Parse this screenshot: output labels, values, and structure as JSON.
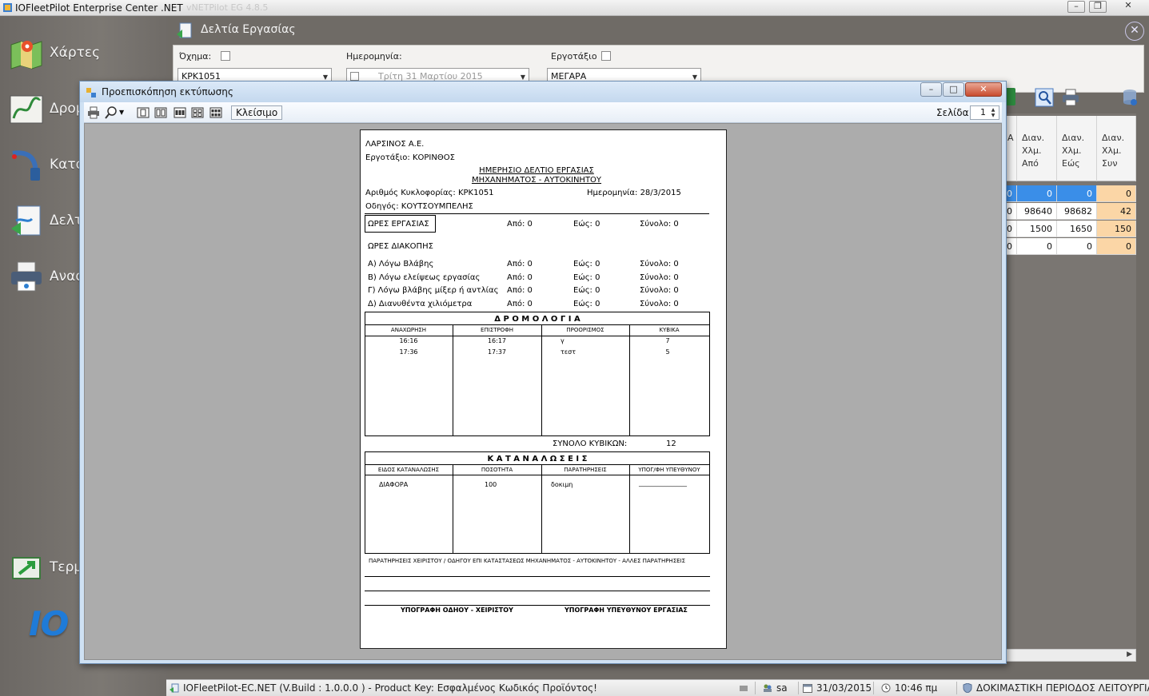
{
  "app": {
    "title": "IOFleetPilot Enterprise Center .NET",
    "title_ghost": "vNETPilot EG 4.8.5"
  },
  "sidebar": {
    "items": [
      {
        "label": "Χάρτες",
        "icon": "map-icon"
      },
      {
        "label": "Δρομ",
        "icon": "route-icon"
      },
      {
        "label": "Κατα",
        "icon": "fuel-pump-icon"
      },
      {
        "label": "Δελτ",
        "icon": "document-icon"
      },
      {
        "label": "Αναφ",
        "icon": "printer-icon"
      },
      {
        "label": "Τερμ",
        "icon": "exit-icon"
      }
    ],
    "logo": "IO"
  },
  "doc_window": {
    "title": "Δελτία Εργασίας",
    "filters": {
      "vehicle_label": "Όχημα:",
      "vehicle_value": "ΚΡΚ1051",
      "date_label": "Ημερομηνία:",
      "date_value": "Τρίτη     31     Μαρτίου     2015",
      "site_label": "Εργοτάξιο",
      "site_value": "ΜΕΓΑΡΑ"
    },
    "grid": {
      "headers": [
        "Α",
        "Διαν. Χλμ. Από",
        "Διαν. Χλμ. Εώς",
        "Διαν. Χλμ. Συν"
      ],
      "rows": [
        [
          "0",
          "0",
          "0",
          "0"
        ],
        [
          "0",
          "98640",
          "98682",
          "42"
        ],
        [
          "0",
          "1500",
          "1650",
          "150"
        ],
        [
          "0",
          "0",
          "0",
          "0"
        ]
      ]
    }
  },
  "status_bar": {
    "product": "IOFleetPilot-EC.NET (V.Build : 1.0.0.0 ) - Product Key: Εσφαλμένος Κωδικός Προϊόντος!",
    "user": "sa",
    "date": "31/03/2015",
    "time": "10:46 πμ",
    "mode": "ΔΟΚΙΜΑΣΤΙΚΗ ΠΕΡΙΟΔΟΣ ΛΕΙΤΟΥΡΓΙΑΣ"
  },
  "print_preview": {
    "title": "Προεπισκόπηση εκτύπωσης",
    "close_label": "Κλείσιμο",
    "page_label": "Σελίδα",
    "page_value": "1"
  },
  "report": {
    "company": "ΛΑΡΣΙΝΟΣ Α.Ε.",
    "site": "Εργοτάξιο: ΚΟΡΙΝΘΟΣ",
    "title1": "ΗΜΕΡΗΣΙΟ  ΔΕΛΤΙΟ  ΕΡΓΑΣΙΑΣ",
    "title2": "ΜΗΧΑΝΗΜΑΤΟΣ - ΑΥΤΟΚΙΝΗΤΟΥ",
    "plate": "Αριθμός Κυκλοφορίας: ΚΡΚ1051",
    "date": "Ημερομηνία: 28/3/2015",
    "driver": "Οδηγός: ΚΟΥΤΣΟΥΜΠΕΛΗΣ",
    "work_hours_label": "ΩΡΕΣ ΕΡΓΑΣΙΑΣ",
    "work_from": "Από: 0",
    "work_to": "Εώς: 0",
    "work_total": "Σύνολο: 0",
    "break_label": "ΩΡΕΣ ΔΙΑΚΟΠΗΣ",
    "breaks": [
      {
        "label": "Α) Λόγω Βλάβης",
        "from": "Από: 0",
        "to": "Εώς: 0",
        "total": "Σύνολο: 0"
      },
      {
        "label": "Β) Λόγω ελείψεως εργασίας",
        "from": "Από: 0",
        "to": "Εώς: 0",
        "total": "Σύνολο: 0"
      },
      {
        "label": "Γ) Λόγω βλάβης μίξερ ή αντλίας",
        "from": "Από: 0",
        "to": "Εώς: 0",
        "total": "Σύνολο: 0"
      },
      {
        "label": "Δ) Διανυθέντα χιλιόμετρα",
        "from": "Από: 0",
        "to": "Εώς: 0",
        "total": "Σύνολο: 0"
      }
    ],
    "routes_title": "Δ Ρ Ο Μ Ο Λ Ο Γ Ι Α",
    "routes_headers": [
      "ΑΝΑΧΩΡΗΣΗ",
      "ΕΠΙΣΤΡΟΦΗ",
      "ΠΡΟΟΡΙΣΜΟΣ",
      "ΚΥΒΙΚΑ"
    ],
    "routes_rows": [
      [
        "16:16",
        "16:17",
        "γ",
        "7"
      ],
      [
        "17:36",
        "17:37",
        "τεστ",
        "5"
      ]
    ],
    "total_cubic_label": "ΣΥΝΟΛΟ ΚΥΒΙΚΩΝ:",
    "total_cubic_value": "12",
    "consumption_title": "Κ Α Τ Α Ν Α Λ Ω Σ Ε Ι Σ",
    "consumption_headers": [
      "ΕΙΔΟΣ ΚΑΤΑΝΑΛΩΣΗΣ",
      "ΠΟΣΟΤΗΤΑ",
      "ΠΑΡΑΤΗΡΗΣΕΙΣ",
      "ΥΠΟΓ/ΦΗ ΥΠΕΥΘΥΝΟΥ"
    ],
    "consumption_row": [
      "ΔΙΑΦΟΡΑ",
      "100",
      "δοκιμη",
      "_______________"
    ],
    "remarks_label": "ΠΑΡΑΤΗΡΗΣΕΙΣ ΧΕΙΡΙΣΤΟΥ / ΟΔΗΓΟΥ ΕΠΙ ΚΑΤΑΣΤΑΣΕΩΣ ΜΗΧΑΝΗΜΑΤΟΣ - ΑΥΤΟΚΙΝΗΤΟΥ - ΑΛΛΕΣ ΠΑΡΑΤΗΡΗΣΕΙΣ",
    "sig_driver": "ΥΠΟΓΡΑΦΗ ΟΔΗΟΥ - ΧΕΙΡΙΣΤΟΥ",
    "sig_manager": "ΥΠΟΓΡΑΦΗ ΥΠΕΥΘΥΝΟΥ ΕΡΓΑΣΙΑΣ"
  }
}
